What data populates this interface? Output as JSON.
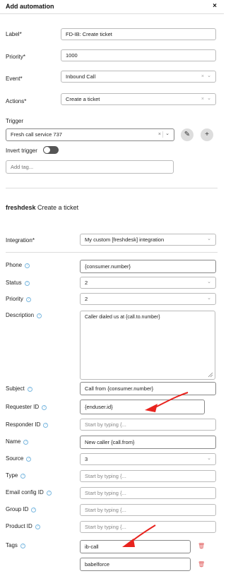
{
  "header": {
    "title": "Add automation",
    "close_glyph": "×"
  },
  "form": {
    "label": {
      "label": "Label",
      "value": "FD-IB: Create ticket"
    },
    "priority": {
      "label": "Priority",
      "value": "1000"
    },
    "event": {
      "label": "Event",
      "value": "Inbound Call"
    },
    "actions": {
      "label": "Actions",
      "value": "Create a ticket"
    },
    "trigger": {
      "label": "Trigger",
      "value": "Fresh call service 737"
    },
    "invert_trigger": {
      "label": "Invert trigger",
      "enabled": false
    },
    "tags": {
      "placeholder": "Add tag..."
    }
  },
  "section": {
    "brand": "freshdesk",
    "title": "Create a ticket"
  },
  "integration": {
    "label": "Integration",
    "value": "My custom [freshdesk] integration"
  },
  "fields": {
    "phone": {
      "label": "Phone",
      "value": "{consumer.number}"
    },
    "status": {
      "label": "Status",
      "value": "2"
    },
    "priority": {
      "label": "Priority",
      "value": "2"
    },
    "description": {
      "label": "Description",
      "value": "Caller dialed us at {call.to.number}"
    },
    "subject": {
      "label": "Subject",
      "value": "Call from {consumer.number}"
    },
    "requester_id": {
      "label": "Requester ID",
      "value": "{enduser.id}"
    },
    "responder_id": {
      "label": "Responder ID",
      "placeholder": "Start by typing {..."
    },
    "name": {
      "label": "Name",
      "value": "New caller {call.from}"
    },
    "source": {
      "label": "Source",
      "value": "3"
    },
    "type": {
      "label": "Type",
      "placeholder": "Start by typing {..."
    },
    "email_config_id": {
      "label": "Email config ID",
      "placeholder": "Start by typing {..."
    },
    "group_id": {
      "label": "Group ID",
      "placeholder": "Start by typing {..."
    },
    "product_id": {
      "label": "Product ID",
      "placeholder": "Start by typing {..."
    },
    "tags": {
      "label": "Tags",
      "values": [
        "ib-call",
        "babelforce"
      ]
    }
  },
  "icons": {
    "required": "*",
    "info": "?",
    "clear": "×",
    "chevron": "⌄",
    "edit": "✎",
    "add": "+",
    "trash": "🗑"
  },
  "colors": {
    "arrow": "#e8231e",
    "info": "#7ab8e0",
    "trash": "#e05a5a"
  }
}
